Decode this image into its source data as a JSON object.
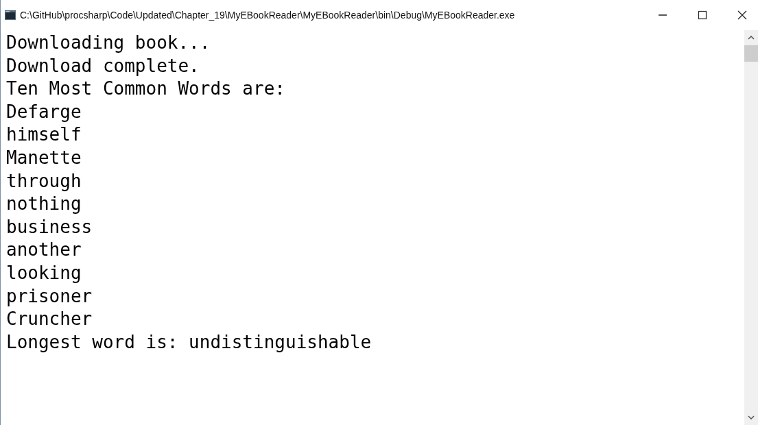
{
  "window": {
    "title": "C:\\GitHub\\procsharp\\Code\\Updated\\Chapter_19\\MyEBookReader\\MyEBookReader\\bin\\Debug\\MyEBookReader.exe"
  },
  "console": {
    "lines": [
      "Downloading book...",
      "Download complete.",
      "Ten Most Common Words are:",
      "Defarge",
      "himself",
      "Manette",
      "through",
      "nothing",
      "business",
      "another",
      "looking",
      "prisoner",
      "Cruncher",
      "Longest word is: undistinguishable"
    ]
  }
}
